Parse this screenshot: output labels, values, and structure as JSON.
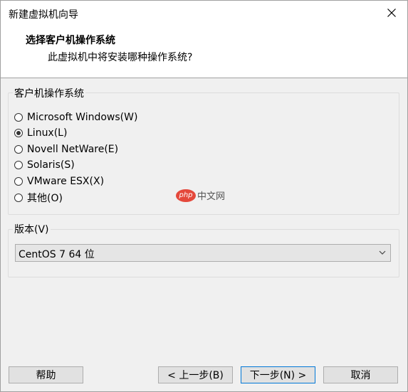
{
  "window": {
    "title": "新建虚拟机向导"
  },
  "header": {
    "title": "选择客户机操作系统",
    "subtitle": "此虚拟机中将安装哪种操作系统?"
  },
  "guest_os": {
    "label": "客户机操作系统",
    "options": [
      {
        "label": "Microsoft Windows(W)",
        "checked": false
      },
      {
        "label": "Linux(L)",
        "checked": true
      },
      {
        "label": "Novell NetWare(E)",
        "checked": false
      },
      {
        "label": "Solaris(S)",
        "checked": false
      },
      {
        "label": "VMware ESX(X)",
        "checked": false
      },
      {
        "label": "其他(O)",
        "checked": false
      }
    ]
  },
  "version": {
    "label": "版本(V)",
    "selected": "CentOS 7 64 位"
  },
  "watermark": {
    "logo_text": "php",
    "text": "中文网"
  },
  "buttons": {
    "help": "帮助",
    "back": "< 上一步(B)",
    "next": "下一步(N) >",
    "cancel": "取消"
  }
}
